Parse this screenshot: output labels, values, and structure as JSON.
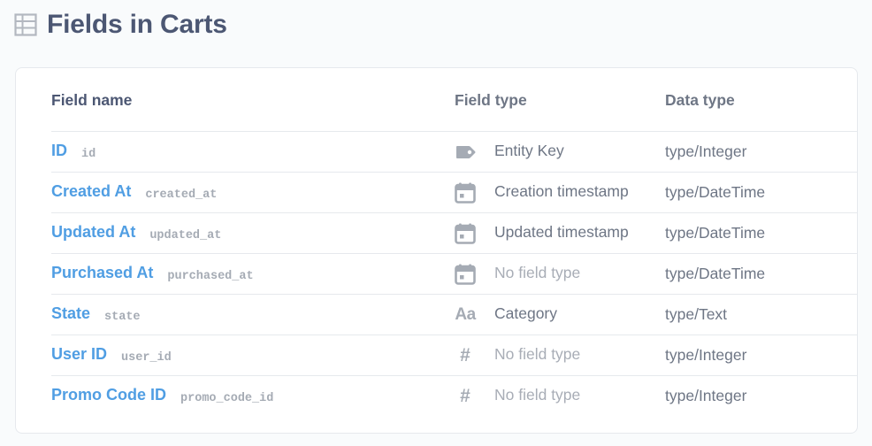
{
  "header": {
    "title": "Fields in Carts",
    "icon": "table-icon"
  },
  "table": {
    "columns": {
      "field_name": "Field name",
      "field_type": "Field type",
      "data_type": "Data type"
    },
    "rows": [
      {
        "display_name": "ID",
        "column_name": "id",
        "field_type": "Entity Key",
        "field_type_icon": "entity-key-icon",
        "data_type": "type/Integer",
        "muted": false
      },
      {
        "display_name": "Created At",
        "column_name": "created_at",
        "field_type": "Creation timestamp",
        "field_type_icon": "calendar-icon",
        "data_type": "type/DateTime",
        "muted": false
      },
      {
        "display_name": "Updated At",
        "column_name": "updated_at",
        "field_type": "Updated timestamp",
        "field_type_icon": "calendar-icon",
        "data_type": "type/DateTime",
        "muted": false
      },
      {
        "display_name": "Purchased At",
        "column_name": "purchased_at",
        "field_type": "No field type",
        "field_type_icon": "calendar-icon",
        "data_type": "type/DateTime",
        "muted": true
      },
      {
        "display_name": "State",
        "column_name": "state",
        "field_type": "Category",
        "field_type_icon": "category-icon",
        "data_type": "type/Text",
        "muted": false
      },
      {
        "display_name": "User ID",
        "column_name": "user_id",
        "field_type": "No field type",
        "field_type_icon": "number-icon",
        "data_type": "type/Integer",
        "muted": true
      },
      {
        "display_name": "Promo Code ID",
        "column_name": "promo_code_id",
        "field_type": "No field type",
        "field_type_icon": "number-icon",
        "data_type": "type/Integer",
        "muted": true
      }
    ]
  },
  "colors": {
    "link": "#509ee3",
    "title": "#4c5773",
    "text": "#6e7685",
    "muted": "#a8adb6",
    "icon": "#a5abb4",
    "border": "#e6e9ed",
    "background": "#f9fbfc"
  }
}
